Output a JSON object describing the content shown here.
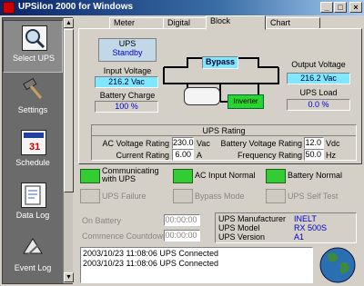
{
  "window": {
    "title": "UPSilon 2000 for Windows",
    "minimize": "_",
    "maximize": "□",
    "close": "×"
  },
  "sidebar": {
    "items": [
      {
        "label": "Select UPS",
        "icon": "magnifier-icon"
      },
      {
        "label": "Settings",
        "icon": "hammer-icon"
      },
      {
        "label": "Schedule",
        "icon": "calendar-icon"
      },
      {
        "label": "Data Log",
        "icon": "data-log-icon"
      },
      {
        "label": "Event Log",
        "icon": "event-log-icon"
      }
    ],
    "scroll_up": "▲",
    "scroll_down": "▼"
  },
  "tabs": [
    {
      "label": "Meter"
    },
    {
      "label": "Digital"
    },
    {
      "label": "Block"
    },
    {
      "label": "Chart"
    }
  ],
  "block": {
    "ups_label": "UPS",
    "ups_state": "Standby",
    "input_voltage_label": "Input Voltage",
    "input_voltage_value": "216.2 Vac",
    "battery_charge_label": "Battery Charge",
    "battery_charge_value": "100 %",
    "bypass_label": "Bypass",
    "inverter_label": "Inverter",
    "output_voltage_label": "Output Voltage",
    "output_voltage_value": "216.2 Vac",
    "ups_load_label": "UPS Load",
    "ups_load_value": "0.0 %"
  },
  "rating": {
    "title": "UPS Rating",
    "ac_voltage_label": "AC Voltage Rating",
    "ac_voltage_value": "230.0",
    "ac_voltage_unit": "Vac",
    "current_label": "Current Rating",
    "current_value": "6.00",
    "current_unit": "A",
    "battery_voltage_label": "Battery Voltage Rating",
    "battery_voltage_value": "12.0",
    "battery_voltage_unit": "Vdc",
    "frequency_label": "Frequency Rating",
    "frequency_value": "50.0",
    "frequency_unit": "Hz"
  },
  "status": {
    "items": [
      {
        "label": "Communicating with UPS",
        "active": true
      },
      {
        "label": "AC Input Normal",
        "active": true
      },
      {
        "label": "Battery Normal",
        "active": true
      },
      {
        "label": "UPS Failure",
        "active": false
      },
      {
        "label": "Bypass Mode",
        "active": false
      },
      {
        "label": "UPS Self Test",
        "active": false
      }
    ]
  },
  "timers": {
    "on_battery_label": "On Battery",
    "on_battery_value": "00:00:00",
    "countdown_label": "Commence Countdown",
    "countdown_value": "00:00:00"
  },
  "ups_info": {
    "manufacturer_label": "UPS Manufacturer",
    "manufacturer_value": "INELT",
    "model_label": "UPS Model",
    "model_value": "RX 500S",
    "version_label": "UPS Version",
    "version_value": "A1"
  },
  "log": {
    "entries": [
      "2003/10/23 11:08:06  UPS Connected",
      "2003/10/23 11:08:06  UPS Connected"
    ]
  },
  "colors": {
    "lcd": "#7fe7ff",
    "status_green": "#33cc33",
    "accent_blue": "#0000c8"
  }
}
